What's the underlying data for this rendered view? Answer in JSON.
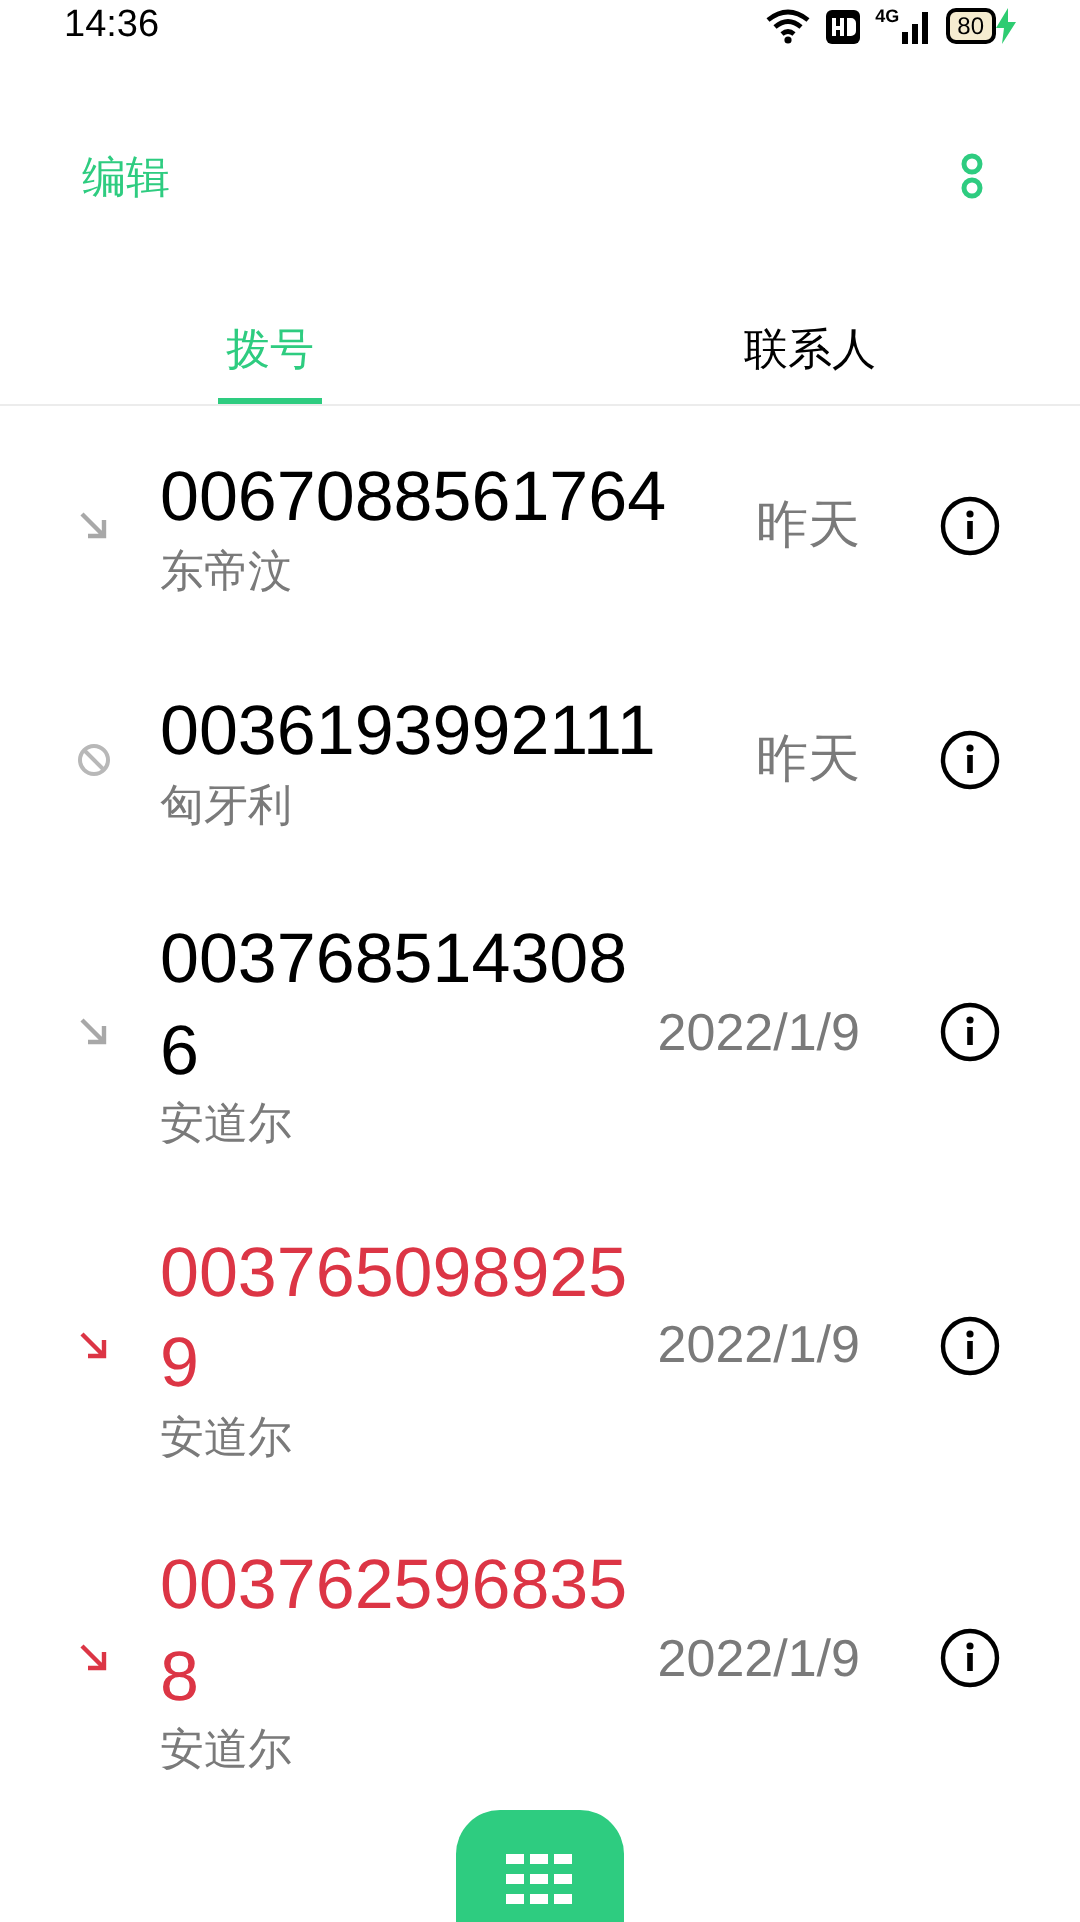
{
  "status_bar": {
    "time": "14:36",
    "network": "4G",
    "battery": "80"
  },
  "header": {
    "edit": "编辑"
  },
  "tabs": [
    {
      "label": "拨号",
      "selected": true
    },
    {
      "label": "联系人",
      "selected": false
    }
  ],
  "calls": [
    {
      "kind": "incoming",
      "number": "0067088561764",
      "name": "东帝汶",
      "date": "昨天"
    },
    {
      "kind": "blocked",
      "number": "0036193992111",
      "name": "匈牙利",
      "date": "昨天"
    },
    {
      "kind": "incoming",
      "number": "0037685143086",
      "name": "安道尔",
      "date": "2022/1/9"
    },
    {
      "kind": "missed",
      "number": "0037650989259",
      "name": "安道尔",
      "date": "2022/1/9"
    },
    {
      "kind": "missed",
      "number": "0037625968358",
      "name": "安道尔",
      "date": "2022/1/9"
    }
  ]
}
